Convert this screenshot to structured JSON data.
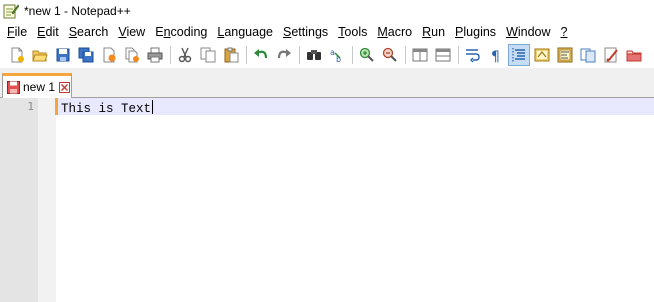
{
  "window": {
    "title": "*new 1 - Notepad++"
  },
  "menubar": {
    "items": [
      {
        "id": "file",
        "hot": "F",
        "rest": "ile"
      },
      {
        "id": "edit",
        "hot": "E",
        "rest": "dit"
      },
      {
        "id": "search",
        "hot": "S",
        "rest": "earch"
      },
      {
        "id": "view",
        "hot": "V",
        "rest": "iew"
      },
      {
        "id": "encoding",
        "pre": "E",
        "hot": "n",
        "rest": "coding"
      },
      {
        "id": "language",
        "hot": "L",
        "rest": "anguage"
      },
      {
        "id": "settings",
        "hot": "S",
        "rest": "ettings"
      },
      {
        "id": "tools",
        "hot": "T",
        "rest": "ools"
      },
      {
        "id": "macro",
        "hot": "M",
        "rest": "acro"
      },
      {
        "id": "run",
        "hot": "R",
        "rest": "un"
      },
      {
        "id": "plugins",
        "hot": "P",
        "rest": "lugins"
      },
      {
        "id": "window",
        "hot": "W",
        "rest": "indow"
      },
      {
        "id": "help",
        "hot": "?",
        "rest": ""
      }
    ]
  },
  "toolbar": {
    "buttons": [
      "new-file-icon",
      "open-file-icon",
      "save-icon",
      "save-all-icon",
      "close-icon",
      "close-all-icon",
      "print-icon",
      "cut-icon",
      "copy-icon",
      "paste-icon",
      "undo-icon",
      "redo-icon",
      "find-icon",
      "replace-icon",
      "zoom-in-icon",
      "zoom-out-icon",
      "sync-vertical-icon",
      "sync-horizontal-icon",
      "word-wrap-icon",
      "show-all-chars-icon",
      "indent-guide-icon",
      "udl-icon",
      "doc-map-icon",
      "function-list-icon",
      "macro-record-icon"
    ],
    "active": "indent-guide-icon"
  },
  "tabs": [
    {
      "label": "new 1",
      "modified": true,
      "active": true
    }
  ],
  "editor": {
    "line_numbers": [
      "1"
    ],
    "lines": [
      "This is Text"
    ],
    "current_line": 1
  },
  "colors": {
    "current_line_bg": "#e8e8ff",
    "gutter_bg": "#e4e4e4",
    "tab_accent": "#f4a53b",
    "modified_marker": "#f4a53b"
  }
}
